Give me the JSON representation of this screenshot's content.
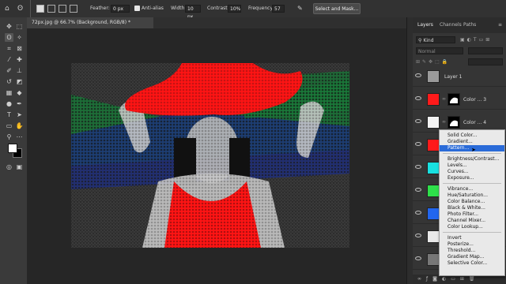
{
  "options_bar": {
    "feather_label": "Feather:",
    "feather_value": "0 px",
    "antialias_label": "Anti-alias",
    "width_label": "Width:",
    "width_value": "10 px",
    "contrast_label": "Contrast:",
    "contrast_value": "10%",
    "frequency_label": "Frequency:",
    "frequency_value": "57",
    "select_mask_label": "Select and Mask..."
  },
  "document": {
    "tab_title": "72px.jpg @ 66.7% (Background, RGB/8) *"
  },
  "layers_panel": {
    "tabs": [
      "Layers",
      "Channels",
      "Paths"
    ],
    "filter_label": "Kind",
    "blend_mode": "Normal",
    "layers": [
      {
        "name": "Layer 1",
        "thumb_color": "#9a9a9a",
        "mask": false
      },
      {
        "name": "Color ... 3",
        "thumb_color": "#ff1a1a",
        "mask": true
      },
      {
        "name": "Color ... 4",
        "thumb_color": "#f2f2f2",
        "mask": true
      },
      {
        "name": "",
        "thumb_color": "#ff1a1a",
        "mask": true
      },
      {
        "name": "",
        "thumb_color": "#18e0e0",
        "mask": false
      },
      {
        "name": "",
        "thumb_color": "#2ee04a",
        "mask": false
      },
      {
        "name": "",
        "thumb_color": "#2266ee",
        "mask": false
      },
      {
        "name": "",
        "thumb_color": "#e8e8e8",
        "mask": false
      },
      {
        "name": "",
        "thumb_color": "#777777",
        "mask": false
      }
    ]
  },
  "adjustment_menu": {
    "groups": [
      [
        "Solid Color...",
        "Gradient...",
        "Pattern..."
      ],
      [
        "Brightness/Contrast...",
        "Levels...",
        "Curves...",
        "Exposure..."
      ],
      [
        "Vibrance...",
        "Hue/Saturation...",
        "Color Balance...",
        "Black & White...",
        "Photo Filter...",
        "Channel Mixer...",
        "Color Lookup..."
      ],
      [
        "Invert",
        "Posterize...",
        "Threshold...",
        "Gradient Map...",
        "Selective Color..."
      ]
    ],
    "highlighted": "Pattern..."
  },
  "tools": [
    "move-tool",
    "marquee-tool",
    "lasso-tool",
    "quick-select-tool",
    "crop-tool",
    "frame-tool",
    "eyedropper-tool",
    "healing-tool",
    "brush-tool",
    "stamp-tool",
    "history-brush-tool",
    "eraser-tool",
    "gradient-tool",
    "blur-tool",
    "dodge-tool",
    "pen-tool",
    "type-tool",
    "path-select-tool",
    "shape-tool",
    "hand-tool",
    "zoom-tool",
    "more-tools"
  ]
}
